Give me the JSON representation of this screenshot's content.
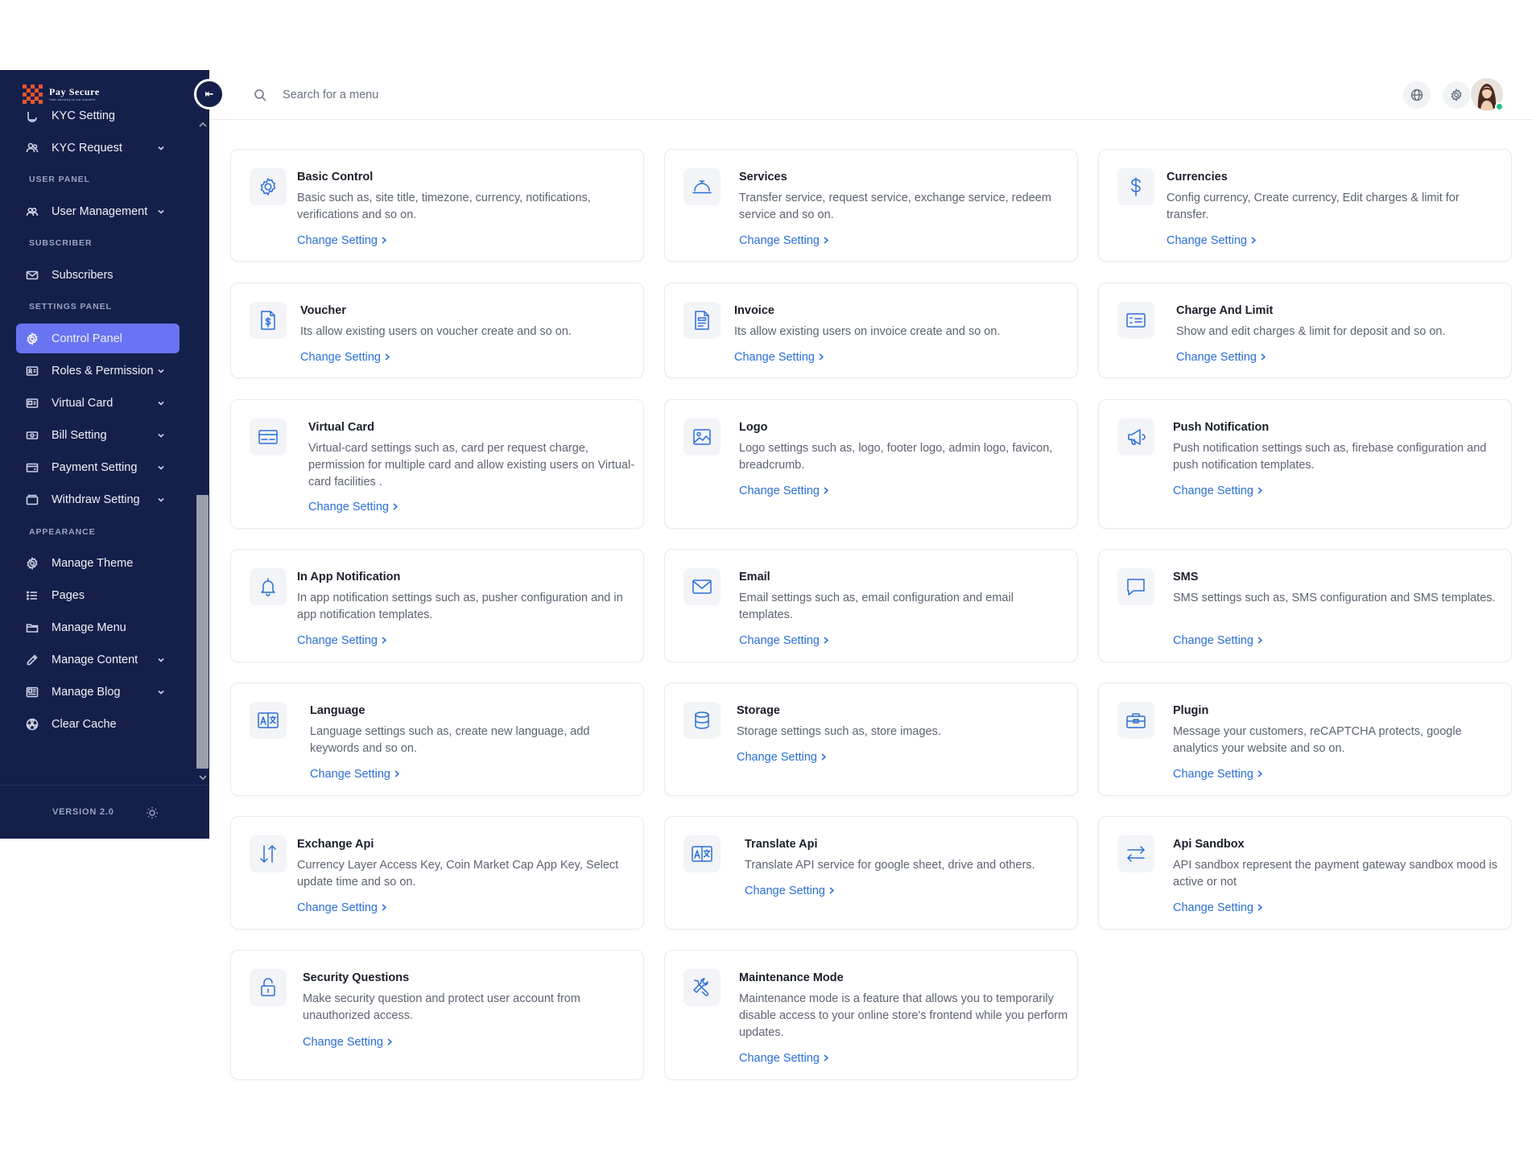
{
  "brand": {
    "name": "Pay Secure",
    "tagline": "Your security is our concern"
  },
  "search": {
    "placeholder": "Search for a menu"
  },
  "sidebar": {
    "items": [
      {
        "label": "KYC Setting",
        "icon": "kyc-icon",
        "chevron": false
      },
      {
        "label": "KYC Request",
        "icon": "users-icon",
        "chevron": true
      },
      {
        "label": "User Management",
        "icon": "user-group-icon",
        "chevron": true
      },
      {
        "label": "Subscribers",
        "icon": "mail-icon",
        "chevron": false
      },
      {
        "label": "Control Panel",
        "icon": "gear-icon",
        "chevron": false,
        "active": true
      },
      {
        "label": "Roles & Permission",
        "icon": "id-card-icon",
        "chevron": true
      },
      {
        "label": "Virtual Card",
        "icon": "card-icon",
        "chevron": true
      },
      {
        "label": "Bill Setting",
        "icon": "bill-icon",
        "chevron": true
      },
      {
        "label": "Payment Setting",
        "icon": "wallet-icon",
        "chevron": true
      },
      {
        "label": "Withdraw Setting",
        "icon": "withdraw-icon",
        "chevron": true
      },
      {
        "label": "Manage Theme",
        "icon": "gear-icon",
        "chevron": false
      },
      {
        "label": "Pages",
        "icon": "list-icon",
        "chevron": false
      },
      {
        "label": "Manage Menu",
        "icon": "folder-icon",
        "chevron": false
      },
      {
        "label": "Manage Content",
        "icon": "pencil-icon",
        "chevron": true
      },
      {
        "label": "Manage Blog",
        "icon": "blog-icon",
        "chevron": true
      },
      {
        "label": "Clear Cache",
        "icon": "radiation-icon",
        "chevron": false
      }
    ],
    "sections": [
      "USER PANEL",
      "SUBSCRIBER",
      "SETTINGS PANEL",
      "APPEARANCE"
    ],
    "version": "VERSION 2.0"
  },
  "link_label": "Change Setting",
  "cards": [
    {
      "title": "Basic Control",
      "desc": "Basic such as, site title, timezone, currency, notifications, verifications and so on.",
      "icon": "gear-icon"
    },
    {
      "title": "Services",
      "desc": "Transfer service, request service, exchange service, redeem service and so on.",
      "icon": "service-bell-icon"
    },
    {
      "title": "Currencies",
      "desc": "Config currency, Create currency, Edit charges & limit for transfer.",
      "icon": "dollar-icon"
    },
    {
      "title": "Voucher",
      "desc": "Its allow existing users on voucher create and so on.",
      "icon": "voucher-icon"
    },
    {
      "title": "Invoice",
      "desc": "Its allow existing users on invoice create and so on.",
      "icon": "invoice-icon"
    },
    {
      "title": "Charge And Limit",
      "desc": "Show and edit charges & limit for deposit and so on.",
      "icon": "charge-icon"
    },
    {
      "title": "Virtual Card",
      "desc": "Virtual-card settings such as, card per request charge, permission for multiple card and allow existing users on Virtual-card facilities .",
      "icon": "credit-card-icon"
    },
    {
      "title": "Logo",
      "desc": "Logo settings such as, logo, footer logo, admin logo, favicon, breadcrumb.",
      "icon": "image-icon"
    },
    {
      "title": "Push Notification",
      "desc": "Push notification settings such as, firebase configuration and push notification templates.",
      "icon": "megaphone-icon"
    },
    {
      "title": "In App Notification",
      "desc": "In app notification settings such as, pusher configuration and in app notification templates.",
      "icon": "bell-icon"
    },
    {
      "title": "Email",
      "desc": "Email settings such as, email configuration and email templates.",
      "icon": "envelope-icon"
    },
    {
      "title": "SMS",
      "desc": "SMS settings such as, SMS configuration and SMS templates.",
      "icon": "chat-icon"
    },
    {
      "title": "Language",
      "desc": "Language settings such as, create new language, add keywords and so on.",
      "icon": "translate-icon"
    },
    {
      "title": "Storage",
      "desc": "Storage settings such as, store images.",
      "icon": "database-icon"
    },
    {
      "title": "Plugin",
      "desc": "Message your customers, reCAPTCHA protects, google analytics your website and so on.",
      "icon": "toolbox-icon"
    },
    {
      "title": "Exchange Api",
      "desc": "Currency Layer Access Key, Coin Market Cap App Key, Select update time and so on.",
      "icon": "arrows-updown-icon"
    },
    {
      "title": "Translate Api",
      "desc": "Translate API service for google sheet, drive and others.",
      "icon": "translate-icon"
    },
    {
      "title": "Api Sandbox",
      "desc": "API sandbox represent the payment gateway sandbox mood is active or not",
      "icon": "arrows-leftright-icon"
    },
    {
      "title": "Security Questions",
      "desc": "Make security question and protect user account from unauthorized access.",
      "icon": "lock-icon"
    },
    {
      "title": "Maintenance Mode",
      "desc": "Maintenance mode is a feature that allows you to temporarily disable access to your online store's frontend while you perform updates.",
      "icon": "tools-icon"
    }
  ],
  "colors": {
    "sidebar_bg": "#14204a",
    "active_bg": "#6a73f2",
    "accent": "#2a6fd6",
    "online": "#22c28a"
  }
}
